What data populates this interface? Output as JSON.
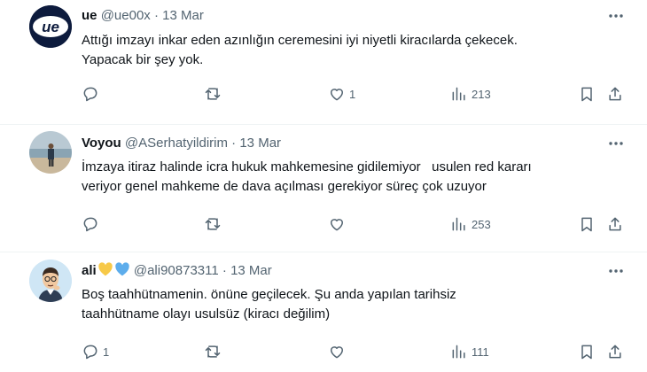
{
  "tweets": [
    {
      "name": "ue",
      "handle": "@ue00x",
      "separator": "·",
      "date": "13 Mar",
      "avatar_icon": "ue-logo-avatar",
      "avatar_text": "ue",
      "lines": [
        "Attığı imzayı inkar eden azınlığın ceremesini iyi niyetli kiracılarda çekecek.",
        "Yapacak bir şey yok."
      ],
      "replies": "",
      "reposts": "",
      "likes": "1",
      "views": "213"
    },
    {
      "name": "Voyou",
      "handle": "@ASerhatyildirim",
      "separator": "·",
      "date": "13 Mar",
      "avatar_icon": "beach-photo-avatar",
      "lines": [
        "İmzaya itiraz halinde icra hukuk mahkemesine gidilemiyor   usulen red kararı",
        "veriyor genel mahkeme de dava açılması gerekiyor süreç çok uzuyor"
      ],
      "replies": "",
      "reposts": "",
      "likes": "",
      "views": "253"
    },
    {
      "name": "ali",
      "name_icons": [
        "yellow-heart-icon",
        "blue-heart-icon"
      ],
      "handle": "@ali90873311",
      "separator": "·",
      "date": "13 Mar",
      "avatar_icon": "cartoon-thinking-man-avatar",
      "lines": [
        "Boş taahhütnamenin. önüne geçilecek. Şu anda yapılan tarihsiz",
        "taahhütname olayı usulsüz (kiracı değilim)"
      ],
      "replies": "1",
      "reposts": "",
      "likes": "",
      "views": "111"
    }
  ],
  "colors": {
    "text": "#0f1419",
    "muted": "#536471",
    "divider": "#eff3f4",
    "yellow_heart": "#f7c948",
    "blue_heart": "#5dadec"
  }
}
